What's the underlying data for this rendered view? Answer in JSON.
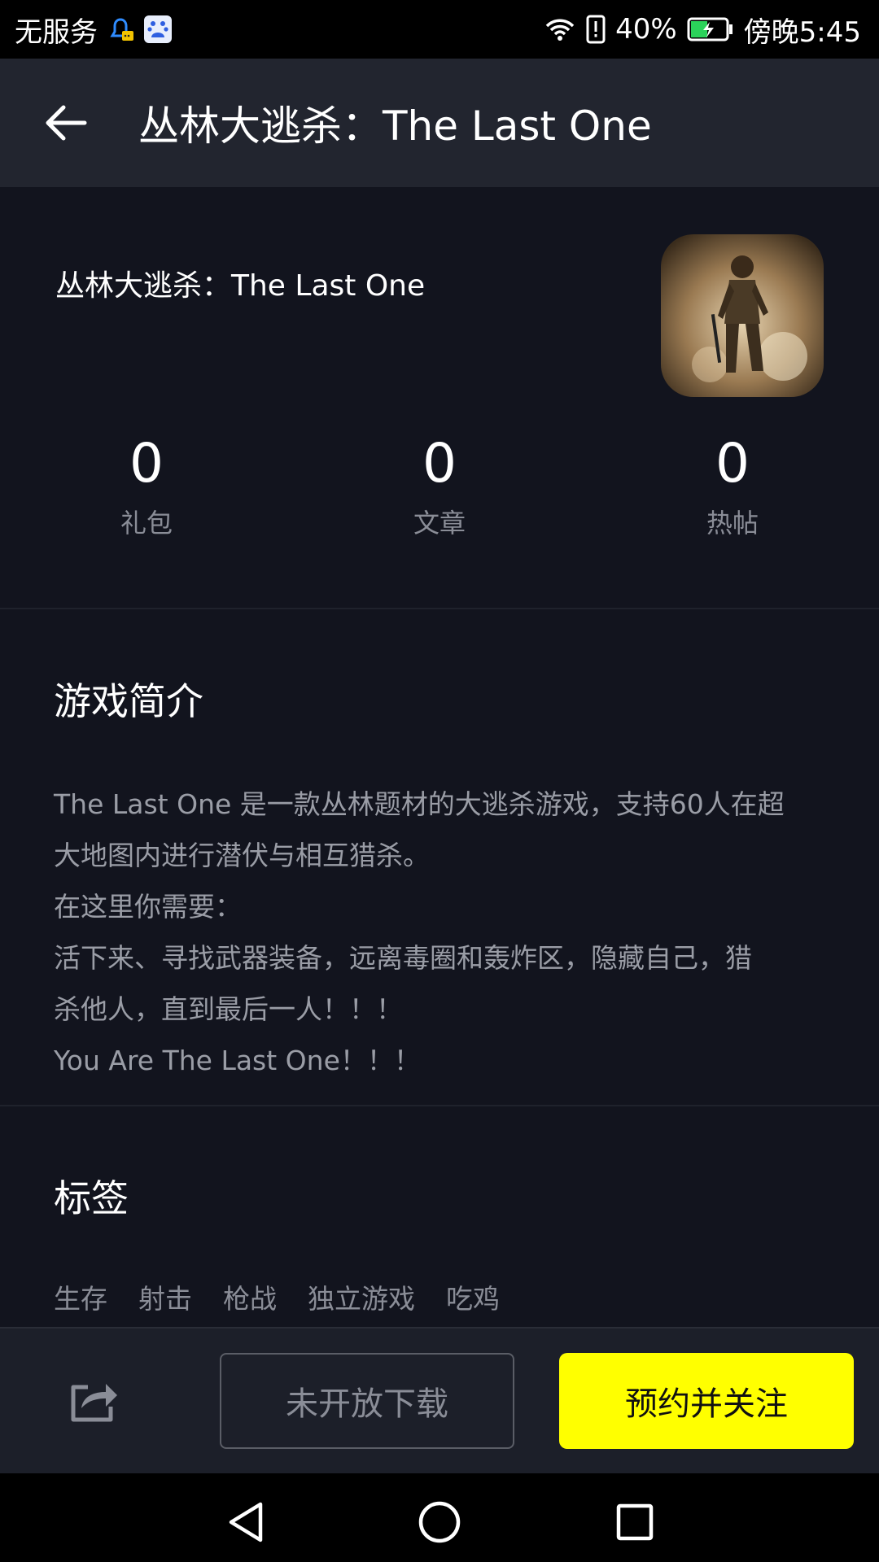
{
  "status_bar": {
    "carrier": "无服务",
    "battery_percent": "40%",
    "time": "傍晚5:45",
    "icons": [
      "notification-icon",
      "baidu-icon",
      "wifi-icon",
      "alert-icon",
      "battery-charging-icon"
    ]
  },
  "app_bar": {
    "back_icon": "arrow-left-icon",
    "title": "丛林大逃杀：The Last One"
  },
  "game": {
    "name": "丛林大逃杀：The Last One",
    "icon": "soldier-game-icon"
  },
  "stats": [
    {
      "value": "0",
      "label": "礼包"
    },
    {
      "value": "0",
      "label": "文章"
    },
    {
      "value": "0",
      "label": "热帖"
    }
  ],
  "intro": {
    "title": "游戏简介",
    "lines": [
      "The Last One 是一款丛林题材的大逃杀游戏，支持60人在超",
      "大地图内进行潜伏与相互猎杀。",
      "在这里你需要：",
      "活下来、寻找武器装备，远离毒圈和轰炸区，隐藏自己，猎",
      "杀他人，直到最后一人！！！",
      "You Are The Last One！！！"
    ]
  },
  "tags": {
    "title": "标签",
    "items": [
      "生存",
      "射击",
      "枪战",
      "独立游戏",
      "吃鸡"
    ]
  },
  "actions": {
    "share_icon": "share-icon",
    "download_label": "未开放下载",
    "reserve_label": "预约并关注",
    "reserve_color": "#ffff00"
  },
  "nav": {
    "icons": [
      "back-triangle-icon",
      "home-circle-icon",
      "recents-square-icon"
    ]
  }
}
